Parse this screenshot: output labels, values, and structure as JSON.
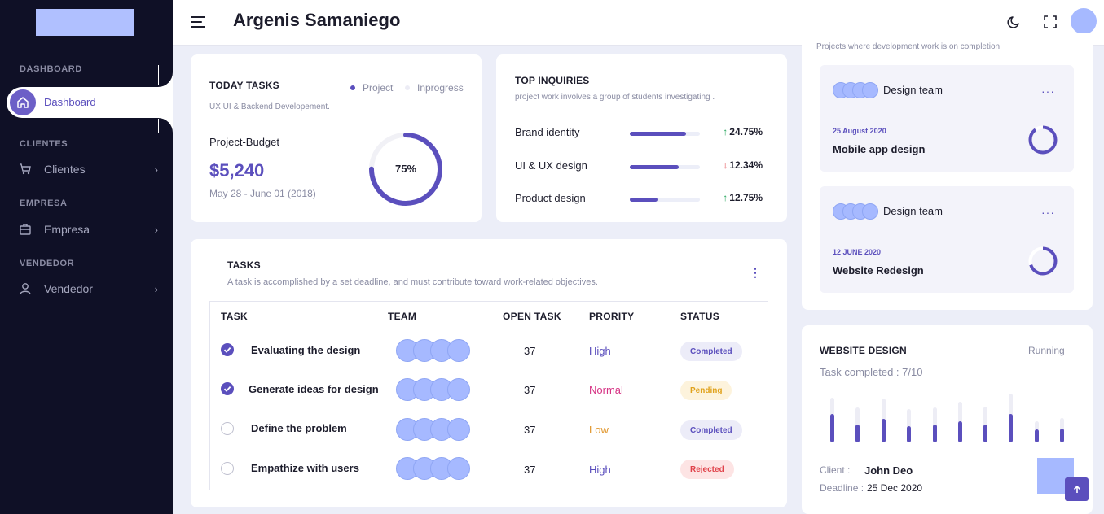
{
  "header": {
    "title": "Argenis Samaniego"
  },
  "sidebar": {
    "sections": [
      {
        "label": "DASHBOARD"
      },
      {
        "label": "CLIENTES"
      },
      {
        "label": "EMPRESA"
      },
      {
        "label": "VENDEDOR"
      }
    ],
    "items": [
      {
        "label": "Dashboard",
        "icon": "home-icon"
      },
      {
        "label": "Clientes",
        "icon": "cart-icon"
      },
      {
        "label": "Empresa",
        "icon": "briefcase-icon"
      },
      {
        "label": "Vendedor",
        "icon": "user-icon"
      }
    ]
  },
  "today_tasks": {
    "title": "TODAY TASKS",
    "subtitle": "UX UI & Backend Developement.",
    "legend": [
      {
        "label": "Project",
        "color": "#5b4fbd"
      },
      {
        "label": "Inprogress",
        "color": "#ececf5"
      }
    ],
    "budget_label": "Project-Budget",
    "budget_value": "$5,240",
    "date_range": "May 28 - June 01 (2018)",
    "progress_label": "75%",
    "progress": 0.75
  },
  "top_inquiries": {
    "title": "TOP INQUIRIES",
    "subtitle": "project work involves a group of students investigating .",
    "rows": [
      {
        "label": "Brand identity",
        "fill": 0.8,
        "pct": "24.75%",
        "trend": "up"
      },
      {
        "label": "UI & UX design",
        "fill": 0.7,
        "pct": "12.34%",
        "trend": "down"
      },
      {
        "label": "Product design",
        "fill": 0.4,
        "pct": "12.75%",
        "trend": "up"
      }
    ]
  },
  "tasks": {
    "title": "TASKS",
    "subtitle": "A task is accomplished by a set deadline, and must contribute toward work-related objectives.",
    "columns": [
      "TASK",
      "TEAM",
      "OPEN TASK",
      "PRORITY",
      "STATUS"
    ],
    "rows": [
      {
        "name": "Evaluating the design",
        "done": true,
        "open": "37",
        "priority": "High",
        "status": "Completed"
      },
      {
        "name": "Generate ideas for design",
        "done": true,
        "open": "37",
        "priority": "Normal",
        "status": "Pending"
      },
      {
        "name": "Define the problem",
        "done": false,
        "open": "37",
        "priority": "Low",
        "status": "Completed"
      },
      {
        "name": "Empathize with users",
        "done": false,
        "open": "37",
        "priority": "High",
        "status": "Rejected"
      }
    ]
  },
  "projects": {
    "subtitle": "Projects where development work is on completion",
    "items": [
      {
        "team_label": "Design team",
        "date": "25 August 2020",
        "name": "Mobile app design",
        "progress": 0.9
      },
      {
        "team_label": "Design team",
        "date": "12 JUNE 2020",
        "name": "Website Redesign",
        "progress": 0.7
      }
    ]
  },
  "website_design": {
    "title": "WEBSITE DESIGN",
    "status": "Running",
    "completed": "Task completed : 7/10",
    "client_label": "Client :",
    "client_value": "John Deo",
    "deadline_label": "Deadline :",
    "deadline_value": "25 Dec 2020",
    "bars": [
      {
        "total": 0.92,
        "done": 0.58
      },
      {
        "total": 0.72,
        "done": 0.36
      },
      {
        "total": 0.9,
        "done": 0.48
      },
      {
        "total": 0.68,
        "done": 0.34
      },
      {
        "total": 0.72,
        "done": 0.36
      },
      {
        "total": 0.84,
        "done": 0.44
      },
      {
        "total": 0.74,
        "done": 0.36
      },
      {
        "total": 1.0,
        "done": 0.58
      },
      {
        "total": 0.44,
        "done": 0.26
      },
      {
        "total": 0.5,
        "done": 0.28
      }
    ]
  },
  "colors": {
    "accent": "#5b4fbd",
    "avatar": "#a6b9ff",
    "sidebar": "#0f1026"
  }
}
